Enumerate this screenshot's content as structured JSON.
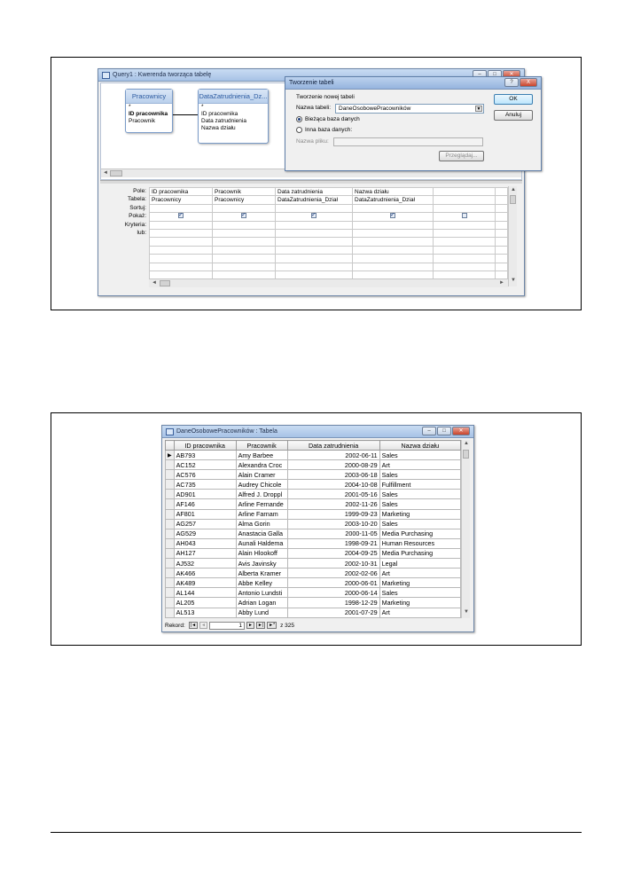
{
  "query_window": {
    "title": "Query1 : Kwerenda tworząca tabelę",
    "tables": [
      {
        "name": "Pracownicy",
        "fields": [
          "*",
          "ID pracownika",
          "Pracownik"
        ]
      },
      {
        "name": "DataZatrudnienia_Dz...",
        "fields": [
          "*",
          "ID pracownika",
          "Data zatrudnienia",
          "Nazwa działu"
        ]
      }
    ],
    "grid_labels": [
      "Pole:",
      "Tabela:",
      "Sortuj:",
      "Pokaż:",
      "Kryteria:",
      "lub:"
    ],
    "columns": [
      {
        "field": "ID pracownika",
        "table": "Pracownicy",
        "show": true
      },
      {
        "field": "Pracownik",
        "table": "Pracownicy",
        "show": true
      },
      {
        "field": "Data zatrudnienia",
        "table": "DataZatrudnienia_Dział",
        "show": true
      },
      {
        "field": "Nazwa działu",
        "table": "DataZatrudnienia_Dział",
        "show": true
      },
      {
        "field": "",
        "table": "",
        "show": false
      }
    ]
  },
  "dialog": {
    "title": "Tworzenie tabeli",
    "group_label": "Tworzenie nowej tabeli",
    "table_name_label": "Nazwa tabeli:",
    "table_name_value": "DaneOsobowePracowników",
    "radio_current": "Bieżąca baza danych",
    "radio_other": "Inna baza danych:",
    "file_label": "Nazwa pliku:",
    "browse": "Przeglądaj...",
    "ok": "OK",
    "cancel": "Anuluj",
    "help": "?",
    "close": "X"
  },
  "table_window": {
    "title": "DaneOsobowePracowników : Tabela",
    "headers": [
      "ID pracownika",
      "Pracownik",
      "Data zatrudnienia",
      "Nazwa działu"
    ],
    "rows": [
      [
        "AB793",
        "Amy Barbee",
        "2002-06-11",
        "Sales"
      ],
      [
        "AC152",
        "Alexandra Croc",
        "2000-08-29",
        "Art"
      ],
      [
        "AC576",
        "Alain Cramer",
        "2003-06-18",
        "Sales"
      ],
      [
        "AC735",
        "Audrey Chicole",
        "2004-10-08",
        "Fulfillment"
      ],
      [
        "AD901",
        "Alfred J. Droppl",
        "2001-05-16",
        "Sales"
      ],
      [
        "AF146",
        "Arline Fernande",
        "2002-11-26",
        "Sales"
      ],
      [
        "AF801",
        "Arline Farnam",
        "1999-09-23",
        "Marketing"
      ],
      [
        "AG257",
        "Alma Gorin",
        "2003-10-20",
        "Sales"
      ],
      [
        "AG529",
        "Anastacia Galla",
        "2000-11-05",
        "Media Purchasing"
      ],
      [
        "AH043",
        "Aunali Haldema",
        "1998-09-21",
        "Human Resources"
      ],
      [
        "AH127",
        "Alain Hlookoff",
        "2004-09-25",
        "Media Purchasing"
      ],
      [
        "AJ532",
        "Avis Javinsky",
        "2002-10-31",
        "Legal"
      ],
      [
        "AK466",
        "Alberta Kramer",
        "2002-02-06",
        "Art"
      ],
      [
        "AK489",
        "Abbe Kelley",
        "2000-06-01",
        "Marketing"
      ],
      [
        "AL144",
        "Antonio Lundsti",
        "2000-06-14",
        "Sales"
      ],
      [
        "AL205",
        "Adrian Logan",
        "1998-12-29",
        "Marketing"
      ],
      [
        "AL513",
        "Abby Lund",
        "2001-07-29",
        "Art"
      ]
    ],
    "record_label": "Rekord:",
    "record_current": "1",
    "record_total": "z 325"
  }
}
